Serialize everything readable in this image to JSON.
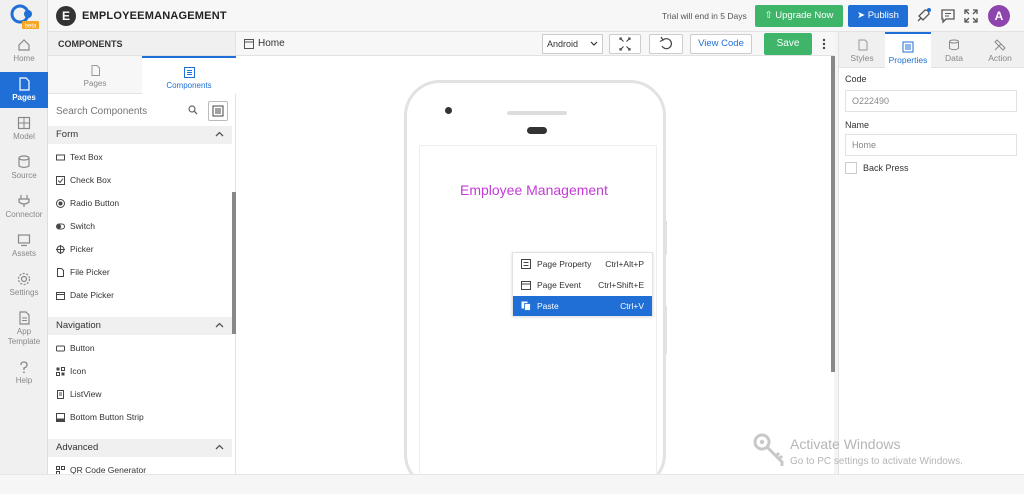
{
  "app": {
    "badge_letter": "E",
    "title": "EMPLOYEEMANAGEMENT",
    "logo_tag": "beta"
  },
  "rail": {
    "items": [
      {
        "label": "Home",
        "icon": "home-icon"
      },
      {
        "label": "Pages",
        "icon": "pages-icon",
        "active": true
      },
      {
        "label": "Model",
        "icon": "model-icon"
      },
      {
        "label": "Source",
        "icon": "database-icon"
      },
      {
        "label": "Connector",
        "icon": "plug-icon"
      },
      {
        "label": "Assets",
        "icon": "assets-icon"
      },
      {
        "label": "Settings",
        "icon": "gear-icon"
      },
      {
        "label": "App",
        "label2": "Template",
        "icon": "template-icon"
      },
      {
        "label": "Help",
        "icon": "help-icon"
      }
    ]
  },
  "topbar": {
    "trial_text": "Trial will end in 5 Days",
    "upgrade_label": "Upgrade Now",
    "publish_label": "Publish",
    "avatar_letter": "A"
  },
  "components": {
    "header": "COMPONENTS",
    "tabs": [
      {
        "label": "Pages",
        "icon": "pages-icon"
      },
      {
        "label": "Components",
        "icon": "list-icon",
        "active": true
      }
    ],
    "search_placeholder": "Search Components",
    "sections": [
      {
        "title": "Form",
        "items": [
          {
            "label": "Text Box",
            "icon": "textbox-icon"
          },
          {
            "label": "Check Box",
            "icon": "checkbox-icon"
          },
          {
            "label": "Radio Button",
            "icon": "radio-icon"
          },
          {
            "label": "Switch",
            "icon": "switch-icon"
          },
          {
            "label": "Picker",
            "icon": "picker-icon"
          },
          {
            "label": "File Picker",
            "icon": "file-icon"
          },
          {
            "label": "Date Picker",
            "icon": "calendar-icon"
          }
        ]
      },
      {
        "title": "Navigation",
        "items": [
          {
            "label": "Button",
            "icon": "button-icon"
          },
          {
            "label": "Icon",
            "icon": "grid-icon"
          },
          {
            "label": "ListView",
            "icon": "list-icon"
          },
          {
            "label": "Bottom Button Strip",
            "icon": "strip-icon"
          }
        ]
      },
      {
        "title": "Advanced",
        "items": [
          {
            "label": "QR Code Generator",
            "icon": "qr-icon"
          }
        ]
      }
    ]
  },
  "canvas": {
    "page_label": "Home",
    "device": "Android",
    "view_code_label": "View Code",
    "save_label": "Save",
    "screen_title": "Employee Management",
    "screen_title_color": "#c23bd4",
    "context_menu": [
      {
        "label": "Page Property",
        "shortcut": "Ctrl+Alt+P",
        "icon": "property-icon"
      },
      {
        "label": "Page Event",
        "shortcut": "Ctrl+Shift+E",
        "icon": "event-icon"
      },
      {
        "label": "Paste",
        "shortcut": "Ctrl+V",
        "icon": "paste-icon",
        "active": true
      }
    ]
  },
  "properties": {
    "tabs": [
      {
        "label": "Styles",
        "icon": "styles-icon"
      },
      {
        "label": "Properties",
        "icon": "properties-icon",
        "active": true
      },
      {
        "label": "Data",
        "icon": "database-icon"
      },
      {
        "label": "Action",
        "icon": "tools-icon"
      }
    ],
    "code_label": "Code",
    "code_value": "O222490",
    "name_label": "Name",
    "name_placeholder": "Home",
    "back_press_label": "Back Press"
  },
  "watermark": {
    "title": "Activate Windows",
    "subtitle": "Go to PC settings to activate Windows."
  },
  "colors": {
    "accent": "#1f6fd6",
    "success": "#3fb56a",
    "avatar": "#8e44ad"
  }
}
